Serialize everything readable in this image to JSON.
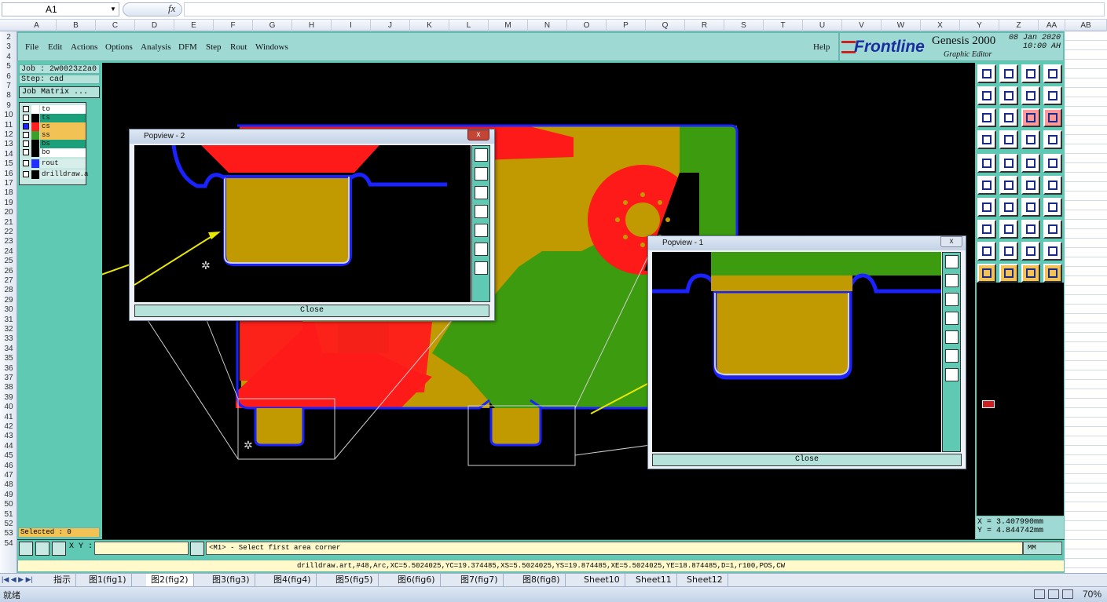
{
  "excel": {
    "name_box": "A1",
    "fx_label": "fx",
    "columns": [
      "A",
      "B",
      "C",
      "D",
      "E",
      "F",
      "G",
      "H",
      "I",
      "J",
      "K",
      "L",
      "M",
      "N",
      "O",
      "P",
      "Q",
      "R",
      "S",
      "T",
      "U",
      "V",
      "W",
      "X",
      "Y",
      "Z",
      "AA",
      "AB"
    ],
    "rows": [
      "2",
      "3",
      "4",
      "5",
      "6",
      "7",
      "8",
      "9",
      "10",
      "11",
      "12",
      "13",
      "14",
      "15",
      "16",
      "17",
      "18",
      "19",
      "20",
      "21",
      "22",
      "23",
      "24",
      "25",
      "26",
      "27",
      "28",
      "29",
      "30",
      "31",
      "32",
      "33",
      "34",
      "35",
      "36",
      "37",
      "38",
      "39",
      "40",
      "41",
      "42",
      "43",
      "44",
      "45",
      "46",
      "47",
      "48",
      "49",
      "50",
      "51",
      "52",
      "53",
      "54"
    ],
    "sheet_tabs": [
      "指示",
      "图1(fig1)",
      "图2(fig2)",
      "图3(fig3)",
      "图4(fig4)",
      "图5(fig5)",
      "图6(fig6)",
      "图7(fig7)",
      "图8(fig8)",
      "Sheet10",
      "Sheet11",
      "Sheet12"
    ],
    "active_tab_index": 2,
    "status": "就绪",
    "zoom": "70%"
  },
  "genesis": {
    "menu": [
      "File",
      "Edit",
      "Actions",
      "Options",
      "Analysis",
      "DFM",
      "Step",
      "Rout",
      "Windows"
    ],
    "help": "Help",
    "brand": {
      "logo": "Frontline",
      "title": "Genesis 2000",
      "subtitle": "Graphic Editor",
      "date": "08 Jan 2020",
      "time": "10:00 AH"
    },
    "job": "Job : 2w0023z2a0",
    "step": "Step: cad",
    "job_matrix": "Job Matrix ...",
    "layers": [
      {
        "name": "to",
        "color": "#ffffff",
        "bg": "#ffffff"
      },
      {
        "name": "ts",
        "color": "#000000",
        "bg": "#1aa07a"
      },
      {
        "name": "cs",
        "color": "#ff2020",
        "bg": "#f2c255"
      },
      {
        "name": "ss",
        "color": "#3aa02a",
        "bg": "#f2c255"
      },
      {
        "name": "bs",
        "color": "#000000",
        "bg": "#1aa07a"
      },
      {
        "name": "bo",
        "color": "#000000",
        "bg": "#ffffff"
      },
      {
        "name": "rout",
        "color": "#2030ff",
        "bg": "#b6e2dc"
      },
      {
        "name": "drilldraw.a",
        "color": "#000000",
        "bg": "#b6e2dc"
      }
    ],
    "selected": "Selected : 0",
    "xy_label": "X Y :",
    "prompt": "<M1> - Select first area corner",
    "unit": "MM",
    "coords": {
      "x": "X = 3.407990mm",
      "y": "Y = 4.844742mm"
    },
    "feature_info": "drilldraw.art,#48,Arc,XC=5.5024025,YC=19.374485,XS=5.5024025,YS=19.874485,XE=5.5024025,YE=18.874485,D=1,r100,POS,CW",
    "popview2": {
      "title": "Popview - 2",
      "close": "Close",
      "close_x": "x"
    },
    "popview1": {
      "title": "Popview - 1",
      "close": "Close",
      "close_x": "x"
    }
  },
  "colors": {
    "teal": "#5fc9b4",
    "red": "#ff1a1a",
    "green": "#3c9b0f",
    "gold": "#c09a00",
    "blue": "#1a22ff",
    "arrow": "#e8e800"
  }
}
